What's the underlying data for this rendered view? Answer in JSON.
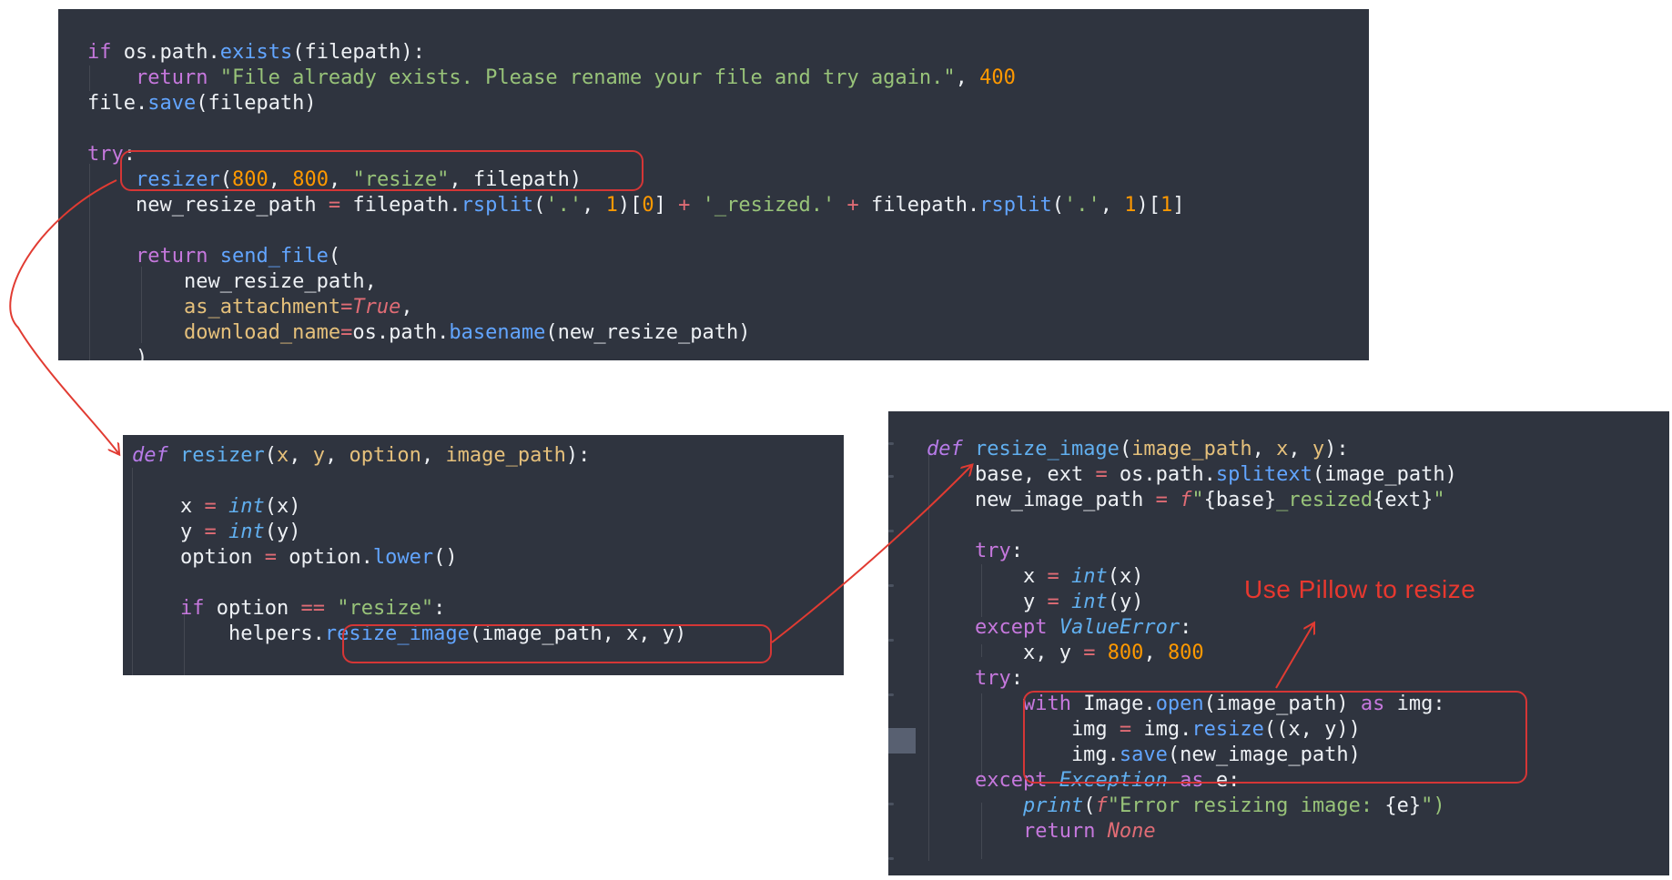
{
  "panels": [
    {
      "id": "top",
      "lines": [
        [
          {
            "t": "if ",
            "c": "t-keyword"
          },
          {
            "t": "os.path.",
            "c": "t-plain"
          },
          {
            "t": "exists",
            "c": "t-func"
          },
          {
            "t": "(filepath):",
            "c": "t-plain"
          }
        ],
        [
          {
            "t": "    ",
            "c": "t-plain"
          },
          {
            "t": "return ",
            "c": "t-keyword"
          },
          {
            "t": "\"File already exists. Please rename your file and try again.\"",
            "c": "t-string"
          },
          {
            "t": ", ",
            "c": "t-plain"
          },
          {
            "t": "400",
            "c": "t-number"
          }
        ],
        [
          {
            "t": "file.",
            "c": "t-plain"
          },
          {
            "t": "save",
            "c": "t-func"
          },
          {
            "t": "(filepath)",
            "c": "t-plain"
          }
        ],
        [],
        [
          {
            "t": "try",
            "c": "t-keyword"
          },
          {
            "t": ":",
            "c": "t-plain"
          }
        ],
        [
          {
            "t": "    ",
            "c": "t-plain"
          },
          {
            "t": "resizer",
            "c": "t-func"
          },
          {
            "t": "(",
            "c": "t-plain"
          },
          {
            "t": "800",
            "c": "t-number"
          },
          {
            "t": ", ",
            "c": "t-plain"
          },
          {
            "t": "800",
            "c": "t-number"
          },
          {
            "t": ", ",
            "c": "t-plain"
          },
          {
            "t": "\"resize\"",
            "c": "t-string"
          },
          {
            "t": ", filepath)",
            "c": "t-plain"
          }
        ],
        [
          {
            "t": "    new_resize_path ",
            "c": "t-plain"
          },
          {
            "t": "=",
            "c": "t-op"
          },
          {
            "t": " filepath.",
            "c": "t-plain"
          },
          {
            "t": "rsplit",
            "c": "t-func"
          },
          {
            "t": "(",
            "c": "t-plain"
          },
          {
            "t": "'.'",
            "c": "t-string"
          },
          {
            "t": ", ",
            "c": "t-plain"
          },
          {
            "t": "1",
            "c": "t-number"
          },
          {
            "t": ")[",
            "c": "t-plain"
          },
          {
            "t": "0",
            "c": "t-number"
          },
          {
            "t": "] ",
            "c": "t-plain"
          },
          {
            "t": "+",
            "c": "t-op"
          },
          {
            "t": " ",
            "c": "t-plain"
          },
          {
            "t": "'_resized.'",
            "c": "t-string"
          },
          {
            "t": " ",
            "c": "t-plain"
          },
          {
            "t": "+",
            "c": "t-op"
          },
          {
            "t": " filepath.",
            "c": "t-plain"
          },
          {
            "t": "rsplit",
            "c": "t-func"
          },
          {
            "t": "(",
            "c": "t-plain"
          },
          {
            "t": "'.'",
            "c": "t-string"
          },
          {
            "t": ", ",
            "c": "t-plain"
          },
          {
            "t": "1",
            "c": "t-number"
          },
          {
            "t": ")[",
            "c": "t-plain"
          },
          {
            "t": "1",
            "c": "t-number"
          },
          {
            "t": "]",
            "c": "t-plain"
          }
        ],
        [],
        [
          {
            "t": "    ",
            "c": "t-plain"
          },
          {
            "t": "return ",
            "c": "t-keyword"
          },
          {
            "t": "send_file",
            "c": "t-func"
          },
          {
            "t": "(",
            "c": "t-plain"
          }
        ],
        [
          {
            "t": "        new_resize_path,",
            "c": "t-plain"
          }
        ],
        [
          {
            "t": "        ",
            "c": "t-plain"
          },
          {
            "t": "as_attachment",
            "c": "t-param"
          },
          {
            "t": "=",
            "c": "t-op"
          },
          {
            "t": "True",
            "c": "t-const"
          },
          {
            "t": ",",
            "c": "t-plain"
          }
        ],
        [
          {
            "t": "        ",
            "c": "t-plain"
          },
          {
            "t": "download_name",
            "c": "t-param"
          },
          {
            "t": "=",
            "c": "t-op"
          },
          {
            "t": "os.path.",
            "c": "t-plain"
          },
          {
            "t": "basename",
            "c": "t-func"
          },
          {
            "t": "(new_resize_path)",
            "c": "t-plain"
          }
        ],
        [
          {
            "t": "    )",
            "c": "t-plain"
          }
        ]
      ]
    },
    {
      "id": "left",
      "lines": [
        [
          {
            "t": "def ",
            "c": "t-italic-def"
          },
          {
            "t": "resizer",
            "c": "t-func-def"
          },
          {
            "t": "(",
            "c": "t-plain"
          },
          {
            "t": "x",
            "c": "t-param"
          },
          {
            "t": ", ",
            "c": "t-plain"
          },
          {
            "t": "y",
            "c": "t-param"
          },
          {
            "t": ", ",
            "c": "t-plain"
          },
          {
            "t": "option",
            "c": "t-param"
          },
          {
            "t": ", ",
            "c": "t-plain"
          },
          {
            "t": "image_path",
            "c": "t-param"
          },
          {
            "t": "):",
            "c": "t-plain"
          }
        ],
        [],
        [
          {
            "t": "    x ",
            "c": "t-plain"
          },
          {
            "t": "=",
            "c": "t-op"
          },
          {
            "t": " ",
            "c": "t-plain"
          },
          {
            "t": "int",
            "c": "t-builtin"
          },
          {
            "t": "(x)",
            "c": "t-plain"
          }
        ],
        [
          {
            "t": "    y ",
            "c": "t-plain"
          },
          {
            "t": "=",
            "c": "t-op"
          },
          {
            "t": " ",
            "c": "t-plain"
          },
          {
            "t": "int",
            "c": "t-builtin"
          },
          {
            "t": "(y)",
            "c": "t-plain"
          }
        ],
        [
          {
            "t": "    option ",
            "c": "t-plain"
          },
          {
            "t": "=",
            "c": "t-op"
          },
          {
            "t": " option.",
            "c": "t-plain"
          },
          {
            "t": "lower",
            "c": "t-func"
          },
          {
            "t": "()",
            "c": "t-plain"
          }
        ],
        [],
        [
          {
            "t": "    ",
            "c": "t-plain"
          },
          {
            "t": "if ",
            "c": "t-keyword"
          },
          {
            "t": "option ",
            "c": "t-plain"
          },
          {
            "t": "==",
            "c": "t-op"
          },
          {
            "t": " ",
            "c": "t-plain"
          },
          {
            "t": "\"resize\"",
            "c": "t-string"
          },
          {
            "t": ":",
            "c": "t-plain"
          }
        ],
        [
          {
            "t": "        helpers.",
            "c": "t-plain"
          },
          {
            "t": "resize_image",
            "c": "t-func"
          },
          {
            "t": "(image_path, x, y)",
            "c": "t-plain"
          }
        ]
      ]
    },
    {
      "id": "right",
      "lines": [
        [
          {
            "t": "def ",
            "c": "t-italic-def"
          },
          {
            "t": "resize_image",
            "c": "t-func-def"
          },
          {
            "t": "(",
            "c": "t-plain"
          },
          {
            "t": "image_path",
            "c": "t-param"
          },
          {
            "t": ", ",
            "c": "t-plain"
          },
          {
            "t": "x",
            "c": "t-param"
          },
          {
            "t": ", ",
            "c": "t-plain"
          },
          {
            "t": "y",
            "c": "t-param"
          },
          {
            "t": "):",
            "c": "t-plain"
          }
        ],
        [
          {
            "t": "    base, ext ",
            "c": "t-plain"
          },
          {
            "t": "=",
            "c": "t-op"
          },
          {
            "t": " os.path.",
            "c": "t-plain"
          },
          {
            "t": "splitext",
            "c": "t-func"
          },
          {
            "t": "(image_path)",
            "c": "t-plain"
          }
        ],
        [
          {
            "t": "    new_image_path ",
            "c": "t-plain"
          },
          {
            "t": "=",
            "c": "t-op"
          },
          {
            "t": " ",
            "c": "t-plain"
          },
          {
            "t": "f",
            "c": "t-const"
          },
          {
            "t": "\"",
            "c": "t-string"
          },
          {
            "t": "{base}",
            "c": "t-plain"
          },
          {
            "t": "_resized",
            "c": "t-string"
          },
          {
            "t": "{ext}",
            "c": "t-plain"
          },
          {
            "t": "\"",
            "c": "t-string"
          }
        ],
        [],
        [
          {
            "t": "    ",
            "c": "t-plain"
          },
          {
            "t": "try",
            "c": "t-keyword"
          },
          {
            "t": ":",
            "c": "t-plain"
          }
        ],
        [
          {
            "t": "        x ",
            "c": "t-plain"
          },
          {
            "t": "=",
            "c": "t-op"
          },
          {
            "t": " ",
            "c": "t-plain"
          },
          {
            "t": "int",
            "c": "t-builtin"
          },
          {
            "t": "(x)",
            "c": "t-plain"
          }
        ],
        [
          {
            "t": "        y ",
            "c": "t-plain"
          },
          {
            "t": "=",
            "c": "t-op"
          },
          {
            "t": " ",
            "c": "t-plain"
          },
          {
            "t": "int",
            "c": "t-builtin"
          },
          {
            "t": "(y)",
            "c": "t-plain"
          }
        ],
        [
          {
            "t": "    ",
            "c": "t-plain"
          },
          {
            "t": "except ",
            "c": "t-keyword"
          },
          {
            "t": "ValueError",
            "c": "t-type"
          },
          {
            "t": ":",
            "c": "t-plain"
          }
        ],
        [
          {
            "t": "        x, y ",
            "c": "t-plain"
          },
          {
            "t": "=",
            "c": "t-op"
          },
          {
            "t": " ",
            "c": "t-plain"
          },
          {
            "t": "800",
            "c": "t-number"
          },
          {
            "t": ", ",
            "c": "t-plain"
          },
          {
            "t": "800",
            "c": "t-number"
          }
        ],
        [
          {
            "t": "    ",
            "c": "t-plain"
          },
          {
            "t": "try",
            "c": "t-keyword"
          },
          {
            "t": ":",
            "c": "t-plain"
          }
        ],
        [
          {
            "t": "        ",
            "c": "t-plain"
          },
          {
            "t": "with ",
            "c": "t-keyword"
          },
          {
            "t": "Image.",
            "c": "t-plain"
          },
          {
            "t": "open",
            "c": "t-func"
          },
          {
            "t": "(image_path) ",
            "c": "t-plain"
          },
          {
            "t": "as ",
            "c": "t-keyword"
          },
          {
            "t": "img:",
            "c": "t-plain"
          }
        ],
        [
          {
            "t": "            img ",
            "c": "t-plain"
          },
          {
            "t": "=",
            "c": "t-op"
          },
          {
            "t": " img.",
            "c": "t-plain"
          },
          {
            "t": "resize",
            "c": "t-func"
          },
          {
            "t": "((x, y))",
            "c": "t-plain"
          }
        ],
        [
          {
            "t": "            img.",
            "c": "t-plain"
          },
          {
            "t": "save",
            "c": "t-func"
          },
          {
            "t": "(new_image_path)",
            "c": "t-plain"
          }
        ],
        [
          {
            "t": "    ",
            "c": "t-plain"
          },
          {
            "t": "except ",
            "c": "t-keyword"
          },
          {
            "t": "Exception",
            "c": "t-type"
          },
          {
            "t": " ",
            "c": "t-plain"
          },
          {
            "t": "as ",
            "c": "t-keyword"
          },
          {
            "t": "e:",
            "c": "t-plain"
          }
        ],
        [
          {
            "t": "        ",
            "c": "t-plain"
          },
          {
            "t": "print",
            "c": "t-builtin"
          },
          {
            "t": "(",
            "c": "t-plain"
          },
          {
            "t": "f",
            "c": "t-const"
          },
          {
            "t": "\"Error resizing image: ",
            "c": "t-string"
          },
          {
            "t": "{e}",
            "c": "t-plain"
          },
          {
            "t": "\")",
            "c": "t-string"
          }
        ],
        [
          {
            "t": "        ",
            "c": "t-plain"
          },
          {
            "t": "return ",
            "c": "t-keyword"
          },
          {
            "t": "None",
            "c": "t-const"
          }
        ]
      ]
    }
  ],
  "annotation": {
    "text": "Use Pillow to resize"
  },
  "colors": {
    "panel_bg": "#2f343f",
    "highlight": "#d53636",
    "arrow": "#e13b32"
  }
}
